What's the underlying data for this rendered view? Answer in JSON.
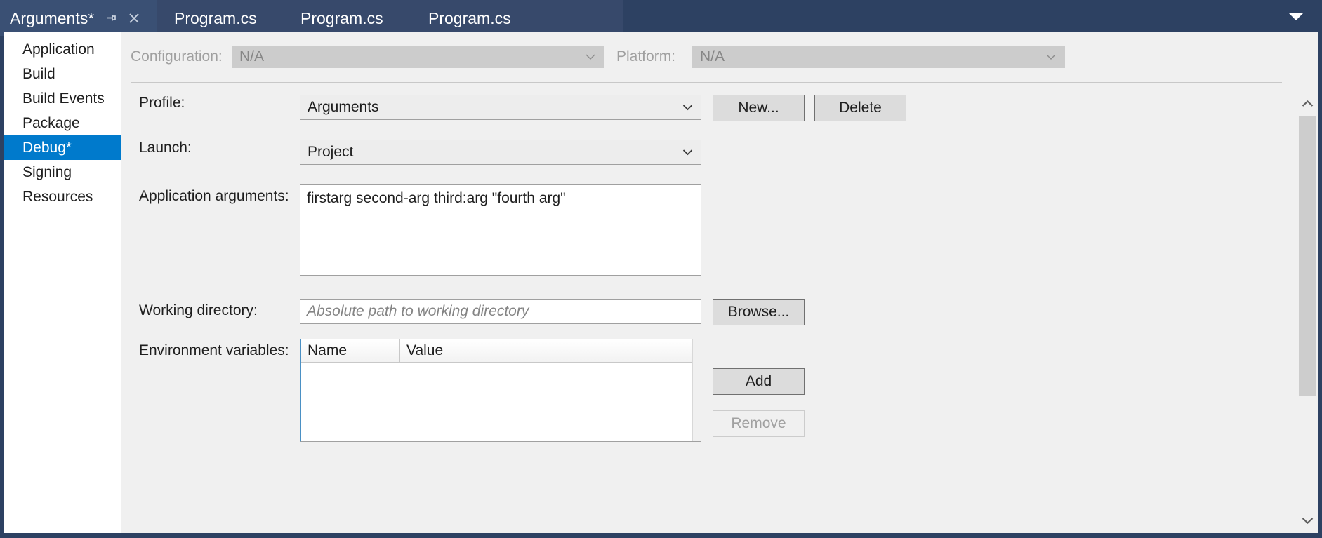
{
  "window": {
    "tabs": {
      "active": {
        "label": "Arguments*",
        "pin_icon": "pin-icon",
        "close_icon": "close-icon"
      },
      "others": [
        {
          "label": "Program.cs"
        },
        {
          "label": "Program.cs"
        },
        {
          "label": "Program.cs"
        }
      ],
      "overflow_icon": "chevron-down-icon"
    }
  },
  "sidebar": {
    "items": [
      {
        "label": "Application",
        "selected": false
      },
      {
        "label": "Build",
        "selected": false
      },
      {
        "label": "Build Events",
        "selected": false
      },
      {
        "label": "Package",
        "selected": false
      },
      {
        "label": "Debug*",
        "selected": true
      },
      {
        "label": "Signing",
        "selected": false
      },
      {
        "label": "Resources",
        "selected": false
      }
    ],
    "selected_color": "#007acc"
  },
  "config_bar": {
    "configuration_label": "Configuration:",
    "configuration_value": "N/A",
    "platform_label": "Platform:",
    "platform_value": "N/A",
    "chevron_icon": "chevron-down-icon"
  },
  "form": {
    "profile": {
      "label": "Profile:",
      "value": "Arguments",
      "chevron_icon": "chevron-down-icon",
      "new_button": "New...",
      "delete_button": "Delete"
    },
    "launch": {
      "label": "Launch:",
      "value": "Project",
      "chevron_icon": "chevron-down-icon"
    },
    "application_arguments": {
      "label": "Application arguments:",
      "value": "firstarg second-arg third:arg \"fourth arg\""
    },
    "working_directory": {
      "label": "Working directory:",
      "value": "",
      "placeholder": "Absolute path to working directory",
      "browse_button": "Browse..."
    },
    "environment_variables": {
      "label": "Environment variables:",
      "columns": [
        "Name",
        "Value"
      ],
      "rows": [],
      "add_button": "Add",
      "remove_button": "Remove",
      "remove_enabled": false
    }
  },
  "scrollbar": {
    "up_icon": "chevron-up-icon",
    "down_icon": "chevron-down-icon"
  }
}
